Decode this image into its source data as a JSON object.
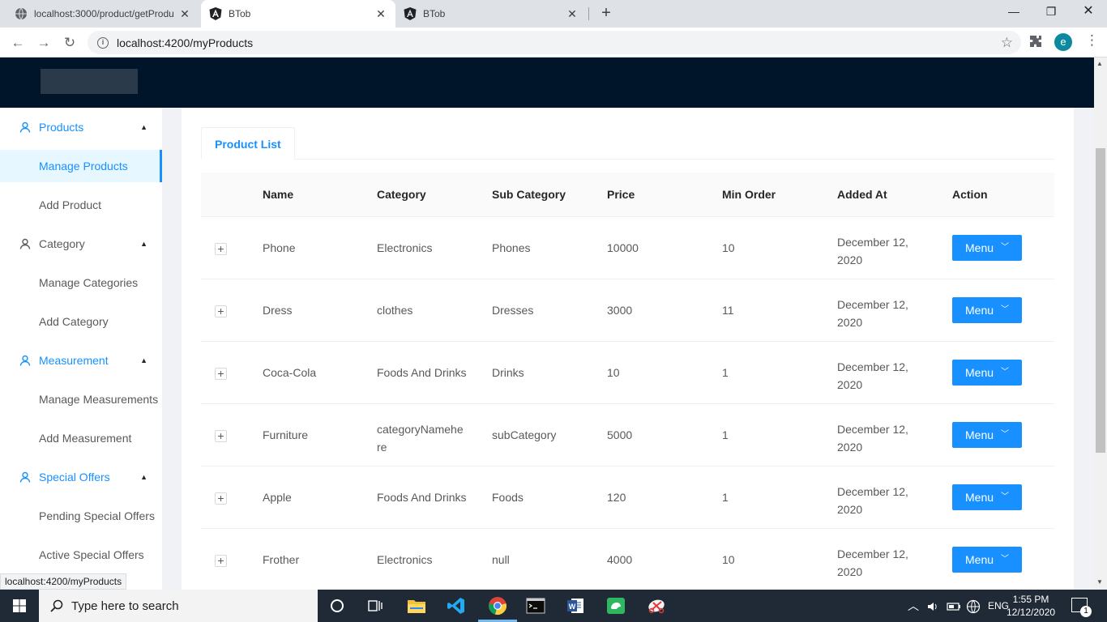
{
  "browser": {
    "tabs": [
      {
        "title": "localhost:3000/product/getProdu",
        "active": false
      },
      {
        "title": "BTob",
        "active": true
      },
      {
        "title": "BTob",
        "active": false
      }
    ],
    "address": "localhost:4200/myProducts",
    "profile_initial": "e",
    "status_url": "localhost:4200/myProducts"
  },
  "sidebar": {
    "groups": [
      {
        "label": "Products",
        "items": [
          "Manage Products",
          "Add Product"
        ]
      },
      {
        "label": "Category",
        "items": [
          "Manage Categories",
          "Add Category"
        ]
      },
      {
        "label": "Measurement",
        "items": [
          "Manage Measurements",
          "Add Measurement"
        ]
      },
      {
        "label": "Special Offers",
        "items": [
          "Pending Special Offers",
          "Active Special Offers"
        ]
      }
    ]
  },
  "main": {
    "tab_label": "Product List",
    "columns": [
      "Name",
      "Category",
      "Sub Category",
      "Price",
      "Min Order",
      "Added At",
      "Action"
    ],
    "rows": [
      {
        "name": "Phone",
        "category": "Electronics",
        "sub_category": "Phones",
        "price": "10000",
        "min_order": "10",
        "added_at_1": "December 12,",
        "added_at_2": "2020",
        "action": "Menu"
      },
      {
        "name": "Dress",
        "category": "clothes",
        "sub_category": "Dresses",
        "price": "3000",
        "min_order": "11",
        "added_at_1": "December 12,",
        "added_at_2": "2020",
        "action": "Menu"
      },
      {
        "name": "Coca-Cola",
        "category": "Foods And Drinks",
        "sub_category": "Drinks",
        "price": "10",
        "min_order": "1",
        "added_at_1": "December 12,",
        "added_at_2": "2020",
        "action": "Menu"
      },
      {
        "name": "Furniture",
        "category_1": "categoryNamehe",
        "category_2": "re",
        "sub_category": "subCategory",
        "price": "5000",
        "min_order": "1",
        "added_at_1": "December 12,",
        "added_at_2": "2020",
        "action": "Menu"
      },
      {
        "name": "Apple",
        "category": "Foods And Drinks",
        "sub_category": "Foods",
        "price": "120",
        "min_order": "1",
        "added_at_1": "December 12,",
        "added_at_2": "2020",
        "action": "Menu"
      },
      {
        "name": "Frother",
        "category": "Electronics",
        "sub_category": "null",
        "price": "4000",
        "min_order": "10",
        "added_at_1": "December 12,",
        "added_at_2": "2020",
        "action": "Menu"
      }
    ]
  },
  "taskbar": {
    "search_placeholder": "Type here to search",
    "language": "ENG",
    "time": "1:55 PM",
    "date": "12/12/2020",
    "notifications": "1"
  },
  "colors": {
    "primary": "#1890ff",
    "header_bg": "#001529",
    "taskbar_bg": "#1f2a36"
  }
}
